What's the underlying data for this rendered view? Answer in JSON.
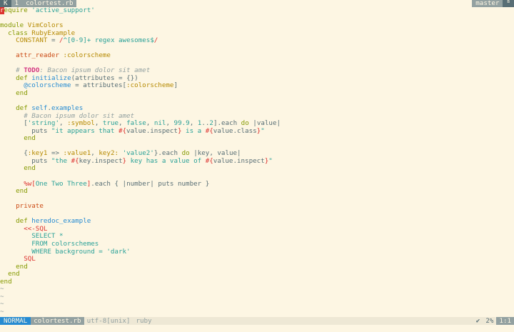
{
  "tabline": {
    "left_icon": "K",
    "tab_number": "1",
    "tab_file": "colortest.rb",
    "branch": "master",
    "branch_icon": "ᴮ"
  },
  "code_lines": [
    "require 'active_support'",
    "",
    "module VimColors",
    "  class RubyExample",
    "    CONSTANT = /^[0-9]+ regex awesomes$/",
    "",
    "    attr_reader :colorscheme",
    "",
    "    # TODO: Bacon ipsum dolor sit amet",
    "    def initialize(attributes = {})",
    "      @colorscheme = attributes[:colorscheme]",
    "    end",
    "",
    "    def self.examples",
    "      # Bacon ipsum dolor sit amet",
    "      ['string', :symbol, true, false, nil, 99.9, 1..2].each do |value|",
    "        puts \"it appears that #{value.inspect} is a #{value.class}\"",
    "      end",
    "",
    "      {:key1 => :value1, key2: 'value2'}.each do |key, value|",
    "        puts \"the #{key.inspect} key has a value of #{value.inspect}\"",
    "      end",
    "",
    "      %w[One Two Three].each { |number| puts number }",
    "    end",
    "",
    "    private",
    "",
    "    def heredoc_example",
    "      <<-SQL",
    "        SELECT *",
    "        FROM colorschemes",
    "        WHERE background = 'dark'",
    "      SQL",
    "    end",
    "  end",
    "end"
  ],
  "tilde": "~",
  "statusline": {
    "mode": "NORMAL",
    "file": "colortest.rb",
    "encoding": "utf-8[unix]",
    "filetype": "ruby",
    "check": "✔",
    "percent": "2%",
    "position": "1:1"
  },
  "colors": {
    "background": "#fdf6e3",
    "mode_bg": "#268bd2",
    "keyword": "#859900",
    "string": "#2aa198",
    "class": "#b58900"
  }
}
